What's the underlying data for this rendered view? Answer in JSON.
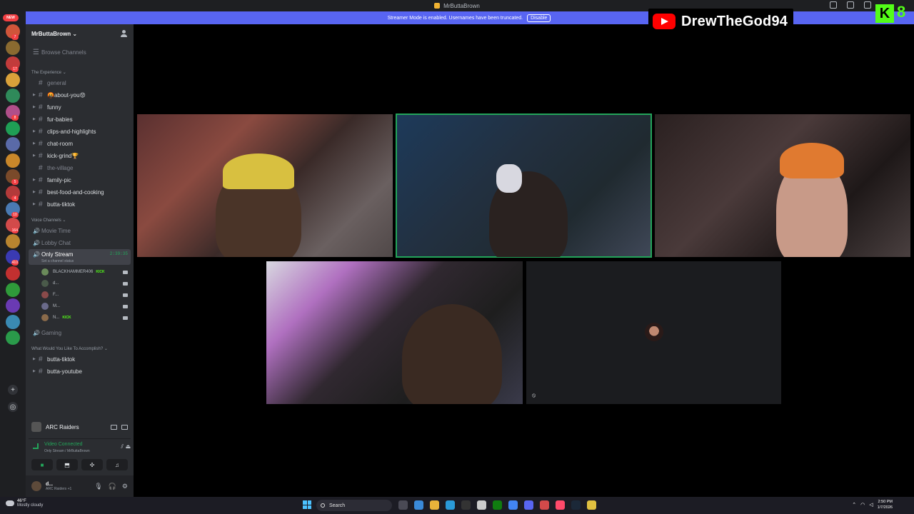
{
  "window": {
    "title": "MrButtaBrown"
  },
  "banner": {
    "text": "Streamer Mode is enabled. Usernames have been truncated.",
    "button": "Disable"
  },
  "overlay": {
    "channel_name": "DrewTheGod94",
    "kick_count": "8"
  },
  "server_rail": {
    "new_label": "NEW",
    "servers": [
      {
        "color": "#d0553a",
        "badge": "7"
      },
      {
        "color": "#8a6a30",
        "badge": ""
      },
      {
        "color": "#c23b3b",
        "badge": "17"
      },
      {
        "color": "#d9a13a",
        "badge": ""
      },
      {
        "color": "#2f8a5a",
        "badge": ""
      },
      {
        "color": "#b04f8a",
        "badge": "8"
      },
      {
        "color": "#1f9e55",
        "badge": ""
      },
      {
        "color": "#5a6aa8",
        "badge": ""
      },
      {
        "color": "#c9872a",
        "badge": ""
      },
      {
        "color": "#7a4a2a",
        "badge": "5"
      },
      {
        "color": "#b33a3a",
        "badge": "4"
      },
      {
        "color": "#4a7ab3",
        "badge": "10"
      },
      {
        "color": "#d24a4a",
        "badge": "164"
      },
      {
        "color": "#b9852f",
        "badge": ""
      },
      {
        "color": "#3a3ab3",
        "badge": "410"
      },
      {
        "color": "#c23030",
        "badge": ""
      },
      {
        "color": "#2f9a3a",
        "badge": ""
      },
      {
        "color": "#6a3ab3",
        "badge": ""
      },
      {
        "color": "#3a8ab3",
        "badge": ""
      },
      {
        "color": "#2a9a4a",
        "badge": ""
      }
    ]
  },
  "sidebar": {
    "server_name": "MrButtaBrown",
    "browse": "Browse Channels",
    "category1": "The Experience",
    "channels1": [
      {
        "name": "general",
        "muted": true
      },
      {
        "name": "🤬about-you😡",
        "muted": false
      },
      {
        "name": "funny",
        "muted": false
      },
      {
        "name": "fur-babies",
        "muted": false
      },
      {
        "name": "clips-and-highlights",
        "muted": false
      },
      {
        "name": "chat-room",
        "muted": false
      },
      {
        "name": "kick-grind🏆",
        "muted": false
      },
      {
        "name": "the-village",
        "muted": true
      },
      {
        "name": "family-pic",
        "muted": false
      },
      {
        "name": "best-food-and-cooking",
        "muted": false
      },
      {
        "name": "butta-tiktok",
        "muted": false
      }
    ],
    "category2": "Voice Channels",
    "voice": [
      {
        "name": "Movie Time"
      },
      {
        "name": "Lobby Chat"
      }
    ],
    "active_voice": {
      "name": "Only Stream",
      "timer": "2:39:35",
      "status": "Set a channel status"
    },
    "voice_users": [
      {
        "name": "BLACKHAMMER406",
        "kick": "KICK",
        "color": "#6a8a5a"
      },
      {
        "name": "d...",
        "kick": "",
        "color": "#4a5a4a"
      },
      {
        "name": "F...",
        "kick": "",
        "color": "#8a4a4a"
      },
      {
        "name": "M...",
        "kick": "",
        "color": "#6a6a8a"
      },
      {
        "name": "N...",
        "kick": "KICK",
        "color": "#8a6a4a"
      }
    ],
    "gaming": "Gaming",
    "category3": "What Would You Like To Accomplish?",
    "channels3": [
      {
        "name": "butta-tiktok"
      },
      {
        "name": "butta-youtube"
      }
    ]
  },
  "game_panel": {
    "game": "ARC Raiders"
  },
  "voice_panel": {
    "status": "Video Connected",
    "sub": "Only Stream / MrButtaBrown"
  },
  "user_panel": {
    "name": "d...",
    "status": "ARC Raiders +1"
  },
  "taskbar": {
    "temp": "46°F",
    "weather": "Mostly cloudy",
    "search": "Search",
    "time": "2:50 PM",
    "date": "1/7/2026",
    "apps": [
      "#4a4a55",
      "#3a8ad8",
      "#e8b33a",
      "#2a9ad8",
      "#333",
      "#ccc",
      "#107c10",
      "#4285f4",
      "#5865f2",
      "#d24a4a",
      "#ff4a6a",
      "#1b2838",
      "#e0c040"
    ]
  }
}
